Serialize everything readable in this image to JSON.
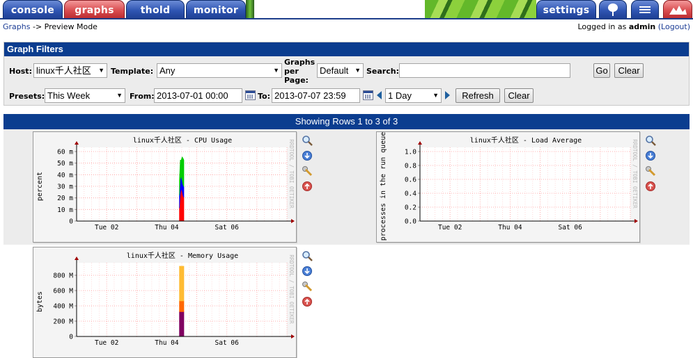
{
  "tabs": {
    "console": "console",
    "graphs": "graphs",
    "thold": "thold",
    "monitor": "monitor",
    "settings": "settings"
  },
  "icon_tabs": [
    "tree-icon",
    "list-icon",
    "preview-icon"
  ],
  "breadcrumb": {
    "link": "Graphs",
    "rest": "-> Preview Mode",
    "logged_in_prefix": "Logged in as",
    "user": "admin",
    "logout": "(Logout)"
  },
  "filters": {
    "title": "Graph Filters",
    "host_label": "Host:",
    "host_value": "linux千人社区",
    "template_label": "Template:",
    "template_value": "Any",
    "gpp_label_1": "Graphs",
    "gpp_label_2": "per",
    "gpp_label_3": "Page:",
    "gpp_value": "Default",
    "search_label": "Search:",
    "search_value": "",
    "go_label": "Go",
    "clear_label": "Clear",
    "presets_label": "Presets:",
    "presets_value": "This Week",
    "from_label": "From:",
    "from_value": "2013-07-01 00:00",
    "to_label": "To:",
    "to_value": "2013-07-07 23:59",
    "shift_value": "1 Day",
    "refresh_label": "Refresh",
    "clear2_label": "Clear"
  },
  "rows_header": "Showing Rows 1 to 3 of 3",
  "graph_icons": [
    "zoom-icon",
    "export-icon",
    "properties-icon",
    "move-up-icon"
  ],
  "watermark": "RRDTOOL / TOBI OETIKER",
  "chart_data": [
    {
      "type": "area",
      "title": "linux千人社区 - CPU Usage",
      "ylabel": "percent",
      "y_ticks": [
        "0",
        "10 m",
        "20 m",
        "30 m",
        "40 m",
        "50 m",
        "60 m"
      ],
      "x_ticks": [
        "Tue 02",
        "Thu 04",
        "Sat 06"
      ],
      "ylim": [
        0,
        0.065
      ],
      "series": [
        {
          "color": "#ff0000",
          "x": [
            4.42,
            4.45,
            4.48,
            4.51,
            4.54,
            4.57
          ],
          "values": [
            0.012,
            0.025,
            0.03,
            0.028,
            0.024,
            0.022
          ]
        },
        {
          "color": "#0000ff",
          "x": [
            4.42,
            4.45,
            4.48,
            4.51,
            4.54,
            4.57
          ],
          "values": [
            0.012,
            0.014,
            0.012,
            0.01,
            0.01,
            0.01
          ]
        },
        {
          "color": "#00cc00",
          "x": [
            4.42,
            4.45,
            4.48,
            4.51,
            4.54,
            4.57
          ],
          "values": [
            0.014,
            0.018,
            0.015,
            0.022,
            0.025,
            0.025
          ]
        }
      ]
    },
    {
      "type": "line",
      "title": "linux千人社区 - Load Average",
      "ylabel": "processes in the run queue",
      "y_ticks": [
        "0.0",
        "0.2",
        "0.4",
        "0.6",
        "0.8",
        "1.0"
      ],
      "x_ticks": [
        "Tue 02",
        "Thu 04",
        "Sat 06"
      ],
      "ylim": [
        0,
        1.0
      ],
      "series": []
    },
    {
      "type": "area",
      "title": "linux千人社区 - Memory Usage",
      "ylabel": "bytes",
      "y_ticks": [
        "0",
        "200 M",
        "400 M",
        "600 M",
        "800 M"
      ],
      "x_ticks": [
        "Tue 02",
        "Thu 04",
        "Sat 06"
      ],
      "ylim": [
        0,
        900
      ],
      "series": [
        {
          "color": "#800060",
          "x": [
            4.42,
            4.57
          ],
          "values": [
            320,
            320
          ]
        },
        {
          "color": "#ff6600",
          "x": [
            4.42,
            4.57
          ],
          "values": [
            140,
            140
          ]
        },
        {
          "color": "#ffbb33",
          "x": [
            4.42,
            4.57
          ],
          "values": [
            450,
            450
          ]
        }
      ]
    }
  ]
}
